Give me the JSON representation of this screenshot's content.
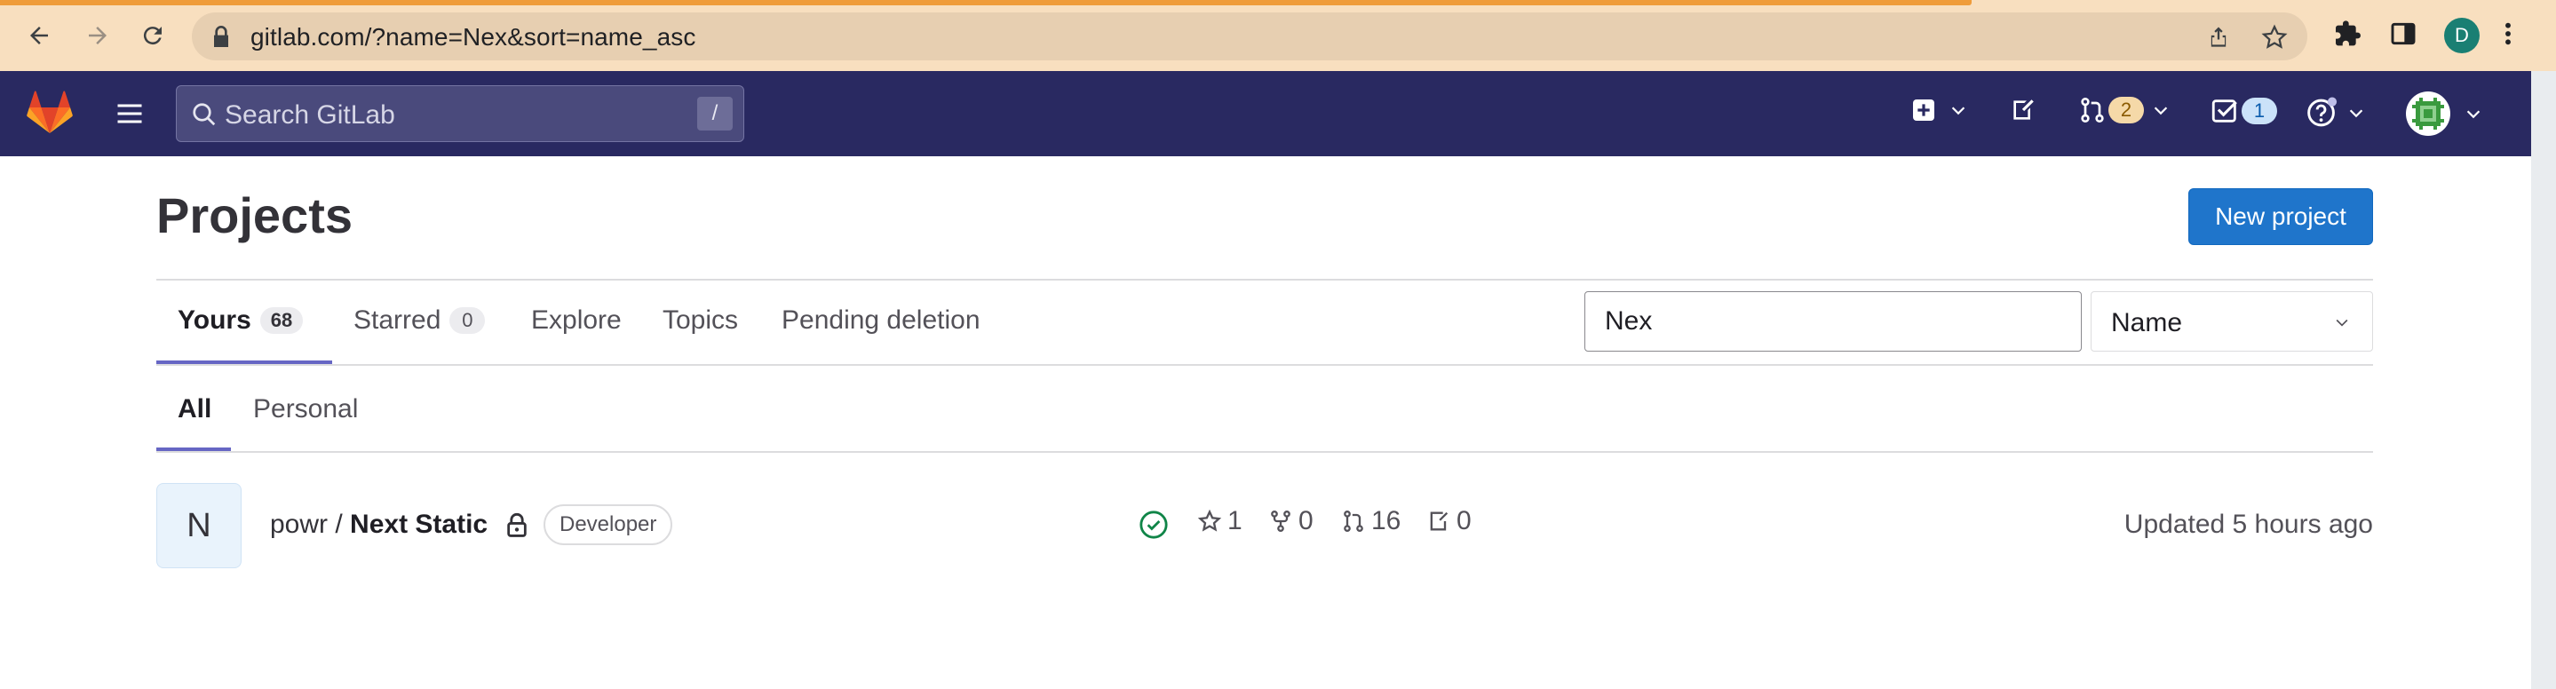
{
  "browser": {
    "url": "gitlab.com/?name=Nex&sort=name_asc",
    "profile_initial": "D"
  },
  "topbar": {
    "search_placeholder": "Search GitLab",
    "search_shortcut": "/",
    "merge_requests_count": "2",
    "todos_count": "1"
  },
  "page": {
    "title": "Projects",
    "new_project_label": "New project"
  },
  "tabs": [
    {
      "label": "Yours",
      "count": "68"
    },
    {
      "label": "Starred",
      "count": "0"
    },
    {
      "label": "Explore"
    },
    {
      "label": "Topics"
    },
    {
      "label": "Pending deletion"
    }
  ],
  "filter": {
    "value": "Nex",
    "sort_label": "Name"
  },
  "subtabs": [
    {
      "label": "All"
    },
    {
      "label": "Personal"
    }
  ],
  "projects": [
    {
      "avatar_letter": "N",
      "namespace": "powr / ",
      "name": "Next Static",
      "role": "Developer",
      "stars": "1",
      "forks": "0",
      "merge_requests": "16",
      "issues": "0",
      "updated": "Updated 5 hours ago"
    }
  ],
  "colors": {
    "topbar": "#292961",
    "primary": "#1f75cb",
    "tab_underline": "#6666c4",
    "pipeline_success": "#108548",
    "chrome": "#f8dfbf"
  }
}
